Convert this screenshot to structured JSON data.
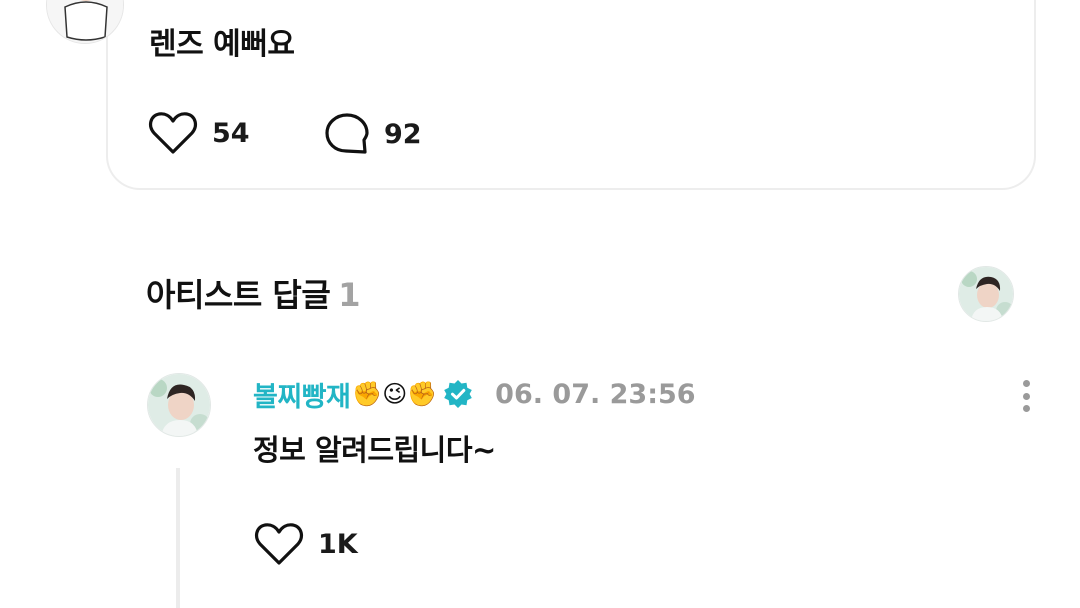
{
  "post": {
    "text": "렌즈 예뻐요",
    "like_count": "54",
    "comment_count": "92",
    "icons": {
      "like": "heart-outline-icon",
      "comment": "speech-bubble-icon"
    }
  },
  "artist_replies": {
    "title": "아티스트 답글",
    "count": "1",
    "reply": {
      "author": "볼찌빵재",
      "author_emoji": "✊😉✊",
      "verified_icon": "verified-badge-icon",
      "timestamp": "06. 07. 23:56",
      "text": "정보 알려드립니다~",
      "like_count": "1K"
    }
  },
  "colors": {
    "accent_name": "#22b5c5",
    "muted": "#9a9a9a",
    "card_border": "#ededed"
  }
}
